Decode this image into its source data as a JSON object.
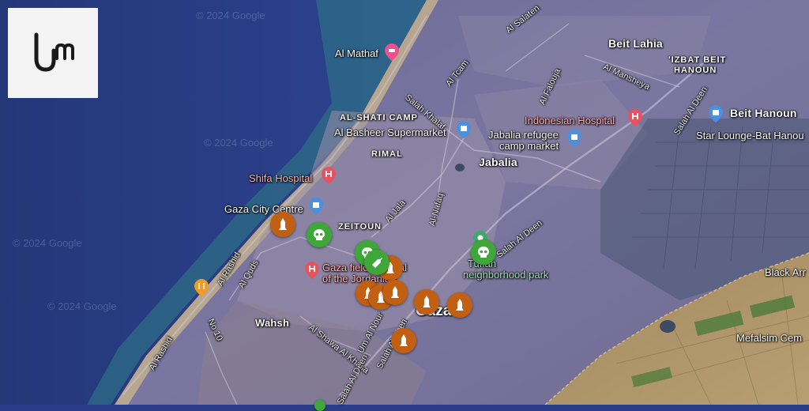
{
  "logo": {
    "name": "um-logo",
    "icon": "um-logo"
  },
  "watermarks": [
    "© 2024 Google",
    "© 2024 Google",
    "© 2024 Google",
    "© 2024 Google"
  ],
  "places": {
    "al_mathaf": "Al Mathaf",
    "beit_lahia": "Beit Lahia",
    "izbat_beit_hanoun_1": "'IZBAT BEIT",
    "izbat_beit_hanoun_2": "HANOUN",
    "al_shati_camp": "AL-SHATI CAMP",
    "al_basheer": "Al Basheer Supermarket",
    "indonesian_hospital": "Indonesian Hospital",
    "beit_hanoun": "Beit Hanoun",
    "star_lounge": "Star Lounge-Bat Hanou",
    "jabalia_market_1": "Jabalia refugee",
    "jabalia_market_2": "camp market",
    "rimal": "RIMAL",
    "jabalia": "Jabalia",
    "shifa_hospital": "Shifa Hospital",
    "gaza_city_centre": "Gaza City Centre",
    "zeitoun": "ZEITOUN",
    "gaza_field_1": "Gaza field hospital",
    "gaza_field_2": "of the Jordanian",
    "tuffah_park_1": "Tuffah",
    "tuffah_park_2": "neighborhood park",
    "black_arrow": "Black Arr",
    "wahsh": "Wahsh",
    "gaza": "Gaza",
    "mefalsim": "Mefalsim Cem"
  },
  "streets": {
    "al_salaten": "Al Salaten",
    "al_tcam": "Al Tcam",
    "salah_khalaf": "Salah Khalaf",
    "al_falouja": "Al Falouja",
    "al_mansheya": "Al Mansheya",
    "salah_al_deen_n": "Salah Al Deen",
    "al_jala": "Al Jala",
    "al_nafaq": "Al-Nafaq",
    "salah_al_deen_m": "Salah Al Deen",
    "al_rashid_n": "Al Rashid",
    "al_quds": "Al Quds",
    "no_10": "No 10",
    "al_shawa": "Al Shawa Al Khasa",
    "um_al_nour": "Um Al Nour",
    "salah_al_deen_s": "Salah Al Deen",
    "al_rashid_s": "Al Rashid"
  },
  "markers": {
    "orange_icon": "missile-icon",
    "green_icon": "skull-icon",
    "orange_color": "#c15f12",
    "green_color": "#3fa639"
  },
  "pins": {
    "hospital_color": "#e8525f",
    "shop_color": "#4a8fe0",
    "food_color": "#f29a21",
    "park_color": "#3fa86b"
  }
}
